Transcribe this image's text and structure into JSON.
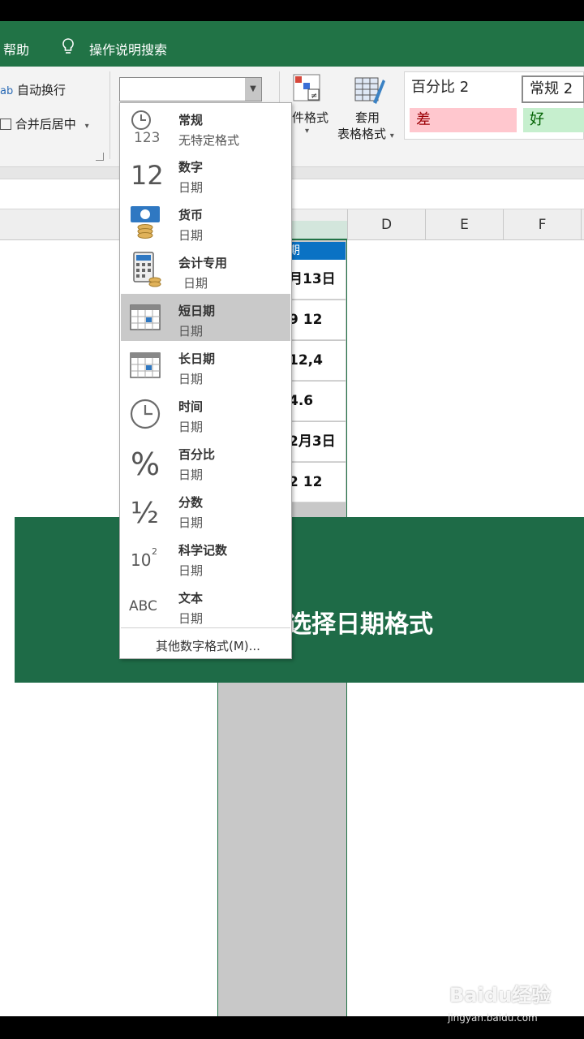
{
  "ribbon_tabs": {
    "help": "帮助",
    "search": "操作说明搜索"
  },
  "ribbon": {
    "wrap_text": "自动换行",
    "merge_center": "合并后居中",
    "conditional_format": "件格式",
    "table_format_line1": "套用",
    "table_format_line2": "表格格式",
    "number_format_value": ""
  },
  "styles": {
    "percent2": "百分比 2",
    "normal2": "常规 2",
    "bad": "差",
    "good": "好"
  },
  "columns": [
    "D",
    "E",
    "F"
  ],
  "cells_c": [
    "月13日",
    "9 12",
    "12,4",
    "4.6",
    "2月3日",
    "2  12"
  ],
  "cell_c_header": "期",
  "banner_text": "选择日期格式",
  "dropdown": {
    "items": [
      {
        "title": "常规",
        "sub": "无特定格式",
        "icon": "clock-123-icon"
      },
      {
        "title": "数字",
        "sub": "日期",
        "icon": "number-12-icon"
      },
      {
        "title": "货币",
        "sub": "日期",
        "icon": "currency-icon"
      },
      {
        "title": "会计专用",
        "sub": "日期",
        "icon": "accounting-icon"
      },
      {
        "title": "短日期",
        "sub": "日期",
        "icon": "short-date-calendar-icon"
      },
      {
        "title": "长日期",
        "sub": "日期",
        "icon": "long-date-calendar-icon"
      },
      {
        "title": "时间",
        "sub": "日期",
        "icon": "clock-icon"
      },
      {
        "title": "百分比",
        "sub": "日期",
        "icon": "percent-icon"
      },
      {
        "title": "分数",
        "sub": "日期",
        "icon": "fraction-icon"
      },
      {
        "title": "科学记数",
        "sub": "日期",
        "icon": "scientific-icon"
      },
      {
        "title": "文本",
        "sub": "日期",
        "icon": "text-abc-icon"
      }
    ],
    "more": "其他数字格式(M)...",
    "selected_index": 4
  },
  "watermark": {
    "brand": "Baidu经验",
    "url": "jingyan.baidu.com"
  },
  "colors": {
    "excel_green": "#217346",
    "banner_green": "#1e6b47",
    "bad_bg": "#ffc7ce",
    "good_bg": "#c6efce",
    "header_blue": "#0a72c4"
  },
  "symbols": {
    "number_icon": "12",
    "percent_icon": "%",
    "fraction_icon": "½",
    "scientific_base": "10",
    "scientific_exp": "2",
    "text_icon": "ABC",
    "clock_digits": "123"
  }
}
